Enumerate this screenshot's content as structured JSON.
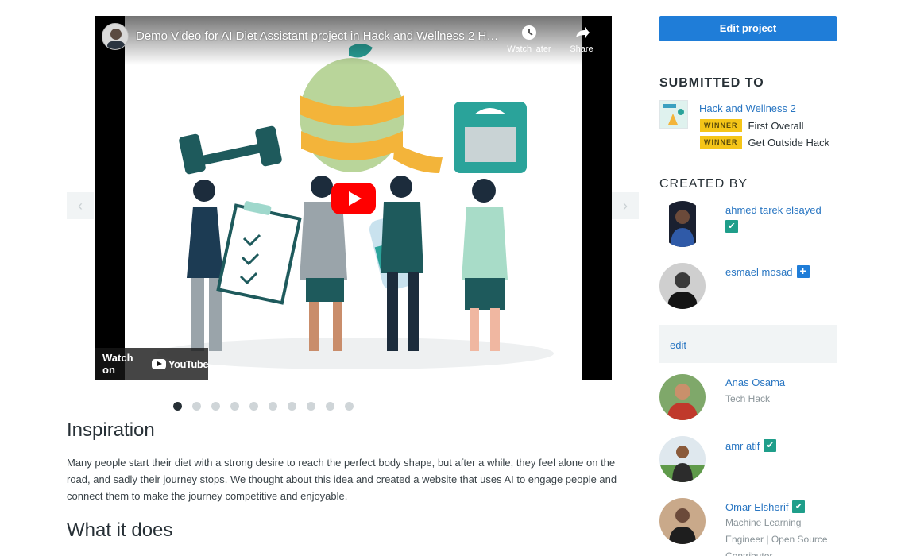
{
  "actions": {
    "edit_project": "Edit project"
  },
  "video": {
    "title": "Demo Video for AI Diet Assistant project in Hack and Wellness 2 Ha...",
    "watch_later": "Watch later",
    "share": "Share",
    "watch_on": "Watch on",
    "youtube": "YouTube",
    "slide_count": 10,
    "active_slide": 1
  },
  "story": {
    "inspiration_heading": "Inspiration",
    "inspiration_text": "Many people start their diet with a strong desire to reach the perfect body shape, but after a while, they feel alone on the road, and sadly their journey stops. We thought about this idea and created a website that uses AI to engage people and connect them to make the journey competitive and enjoyable.",
    "what_heading": "What it does"
  },
  "submitted": {
    "heading": "SUBMITTED TO",
    "hackathon": "Hack and Wellness 2",
    "prizes": [
      {
        "badge": "WINNER",
        "name": "First Overall"
      },
      {
        "badge": "WINNER",
        "name": "Get Outside Hack"
      }
    ]
  },
  "created": {
    "heading": "CREATED BY",
    "members": [
      {
        "name": "ahmed tarek elsayed",
        "badge": "check"
      },
      {
        "name": "esmael mosad",
        "badge": "plus"
      }
    ],
    "edit_label": "edit",
    "more_members": [
      {
        "name": "Anas Osama",
        "sub": "Tech Hack"
      },
      {
        "name": "amr atif",
        "badge": "check"
      },
      {
        "name": "Omar Elsherif",
        "badge": "check",
        "sub": "Machine Learning Engineer | Open Source Contributor"
      }
    ]
  },
  "colors": {
    "accent": "#1f7dd8",
    "winner": "#f5c518",
    "verified": "#1f9e8a",
    "text": "#273036"
  }
}
